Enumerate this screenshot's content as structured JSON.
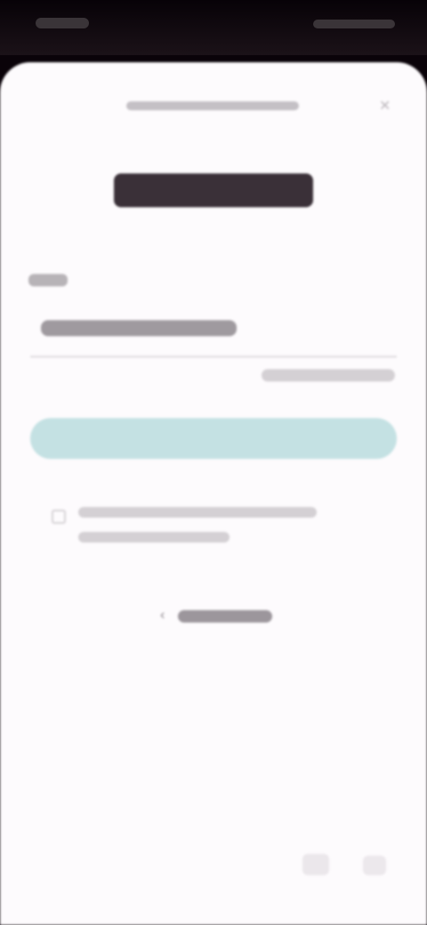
{
  "status_bar": {
    "time": "",
    "icons": ""
  },
  "sheet": {
    "logo_text": "",
    "field_label": "",
    "input_value": "",
    "forgot_link": "",
    "next_button": "",
    "terms_text": "",
    "back_link": ""
  },
  "icons": {
    "close": "close-icon",
    "checkbox": "checkbox-icon",
    "back": "chevron-left-icon"
  },
  "colors": {
    "background": "#fdfbfd",
    "button": "#c4e1e3",
    "status_bar": "#0a0309"
  }
}
